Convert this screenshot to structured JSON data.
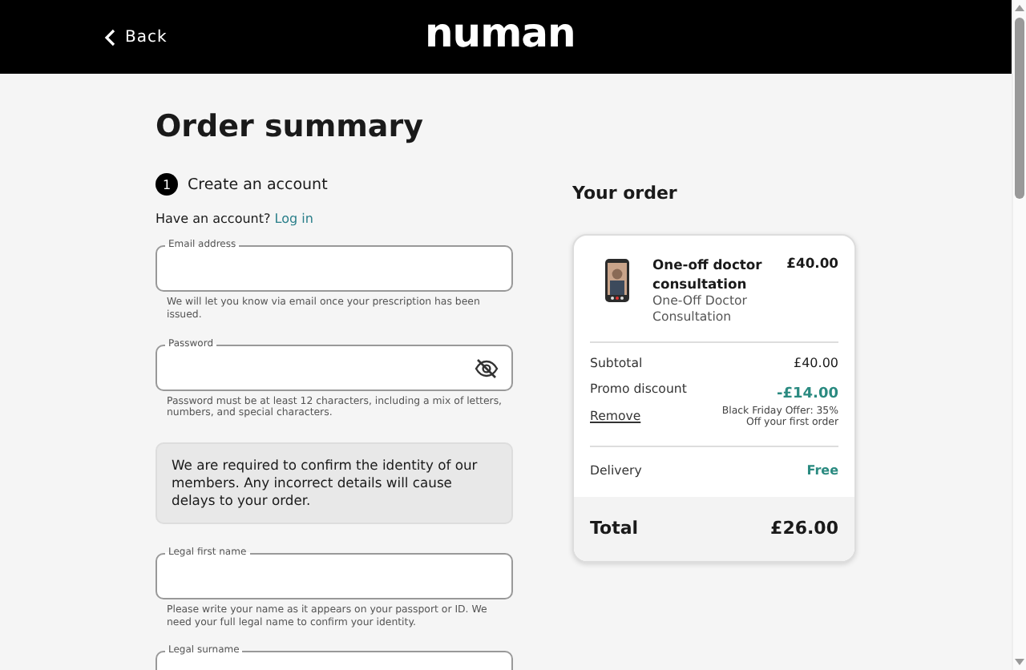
{
  "header": {
    "back": "Back",
    "logo": "numan"
  },
  "title": "Order summary",
  "account": {
    "step": "1",
    "heading": "Create an account",
    "prompt": "Have an account?",
    "login_link": "Log in",
    "fields": [
      {
        "label": "Email address",
        "hint": "We will let you know via email once your prescription has been issued.",
        "kind": "text"
      },
      {
        "label": "Password",
        "hint": "Password must be at least 12 characters, including a mix of letters, numbers, and special characters.",
        "kind": "password"
      }
    ],
    "notice": "We are required to confirm the identity of our members. Any incorrect details will cause delays to your order.",
    "identity_fields": [
      {
        "label": "Legal first name",
        "hint": "Please write your name as it appears on your passport or ID. We need your full legal name to confirm your identity.",
        "kind": "text"
      },
      {
        "label": "Legal surname",
        "kind": "text"
      }
    ]
  },
  "order": {
    "heading": "Your order",
    "product": {
      "name": "One-off doctor consultation",
      "subtitle": "One-Off Doctor Consultation",
      "price": "£40.00"
    },
    "subtotal": {
      "label": "Subtotal",
      "value": "£40.00"
    },
    "promo": {
      "label": "Promo discount",
      "remove": "Remove",
      "value": "-£14.00",
      "note": "Black Friday Offer: 35% Off your first order"
    },
    "delivery": {
      "label": "Delivery",
      "value": "Free"
    },
    "total": {
      "label": "Total",
      "value": "£26.00"
    }
  }
}
